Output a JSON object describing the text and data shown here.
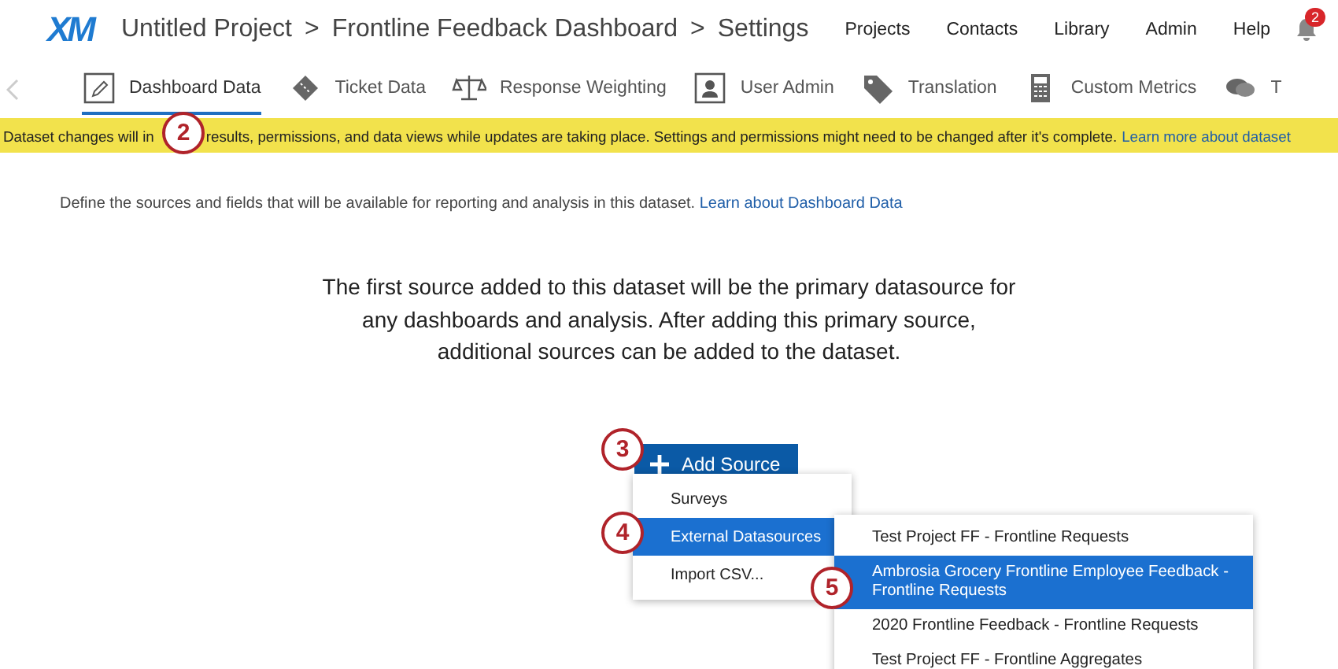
{
  "header": {
    "logo": "XM",
    "breadcrumb": [
      "Untitled Project",
      "Frontline Feedback Dashboard",
      "Settings"
    ],
    "separator": ">",
    "nav": [
      "Projects",
      "Contacts",
      "Library",
      "Admin",
      "Help"
    ],
    "notification_count": "2"
  },
  "tabs": [
    {
      "label": "Dashboard Data",
      "selected": true
    },
    {
      "label": "Ticket Data",
      "selected": false
    },
    {
      "label": "Response Weighting",
      "selected": false
    },
    {
      "label": "User Admin",
      "selected": false
    },
    {
      "label": "Translation",
      "selected": false
    },
    {
      "label": "Custom Metrics",
      "selected": false
    },
    {
      "label": "T",
      "selected": false
    }
  ],
  "banner": {
    "text_start": "Dataset changes will in",
    "text_end": "results, permissions, and data views while updates are taking place. Settings and permissions might need to be changed after it's complete.",
    "link": "Learn more about dataset"
  },
  "description": {
    "text": "Define the sources and fields that will be available for reporting and analysis in this dataset.",
    "link": "Learn about Dashboard Data"
  },
  "intro": "The first source added to this dataset will be the primary datasource for any dashboards and analysis. After adding this primary source, additional sources can be added to the dataset.",
  "add_button": {
    "label": "Add Source"
  },
  "menu": [
    {
      "label": "Surveys",
      "selected": false
    },
    {
      "label": "External Datasources",
      "selected": true
    },
    {
      "label": "Import CSV...",
      "selected": false
    }
  ],
  "submenu": [
    {
      "label": "Test Project FF - Frontline Requests",
      "selected": false
    },
    {
      "label": "Ambrosia Grocery Frontline Employee Feedback - Frontline Requests",
      "selected": true
    },
    {
      "label": "2020 Frontline Feedback - Frontline Requests",
      "selected": false
    },
    {
      "label": "Test Project FF - Frontline Aggregates",
      "selected": false
    }
  ],
  "callouts": [
    "2",
    "3",
    "4",
    "5"
  ]
}
